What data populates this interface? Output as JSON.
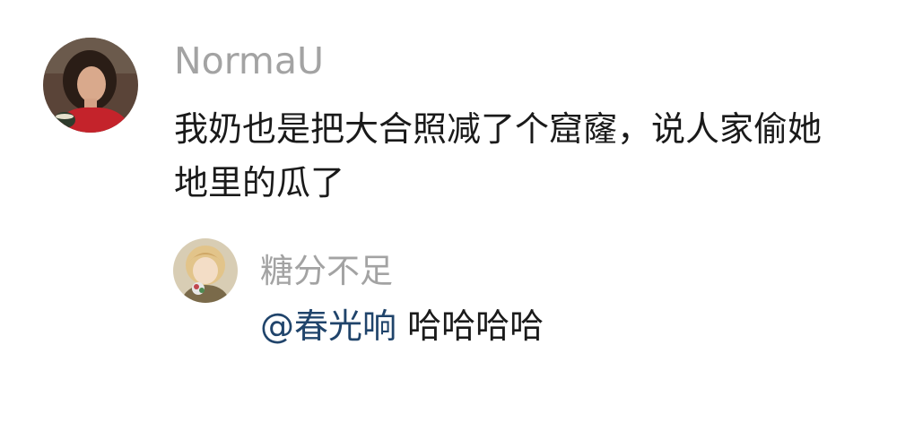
{
  "comments": [
    {
      "username": "NormaU",
      "text_line1": "我奶也是把大合照减了个窟窿，说人家偷她",
      "text_line2": "地里的瓜了"
    },
    {
      "username": "糖分不足",
      "mention": "@春光响",
      "text": "哈哈哈哈"
    }
  ],
  "colors": {
    "username": "#a3a3a3",
    "text": "#1a1a1a",
    "mention": "#20446b",
    "background": "#ffffff"
  }
}
